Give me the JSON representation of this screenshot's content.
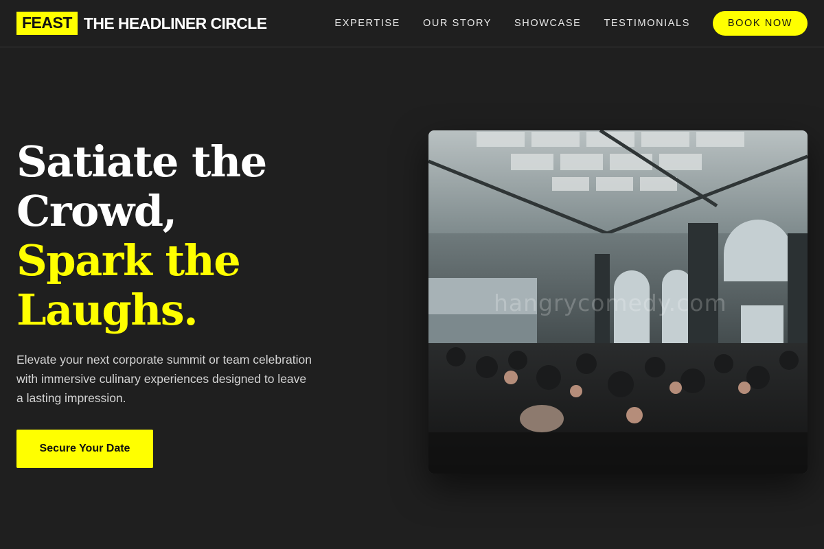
{
  "brand": {
    "badge": "FEAST",
    "name": "THE HEADLINER CIRCLE"
  },
  "nav": {
    "items": [
      {
        "label": "EXPERTISE"
      },
      {
        "label": "OUR STORY"
      },
      {
        "label": "SHOWCASE"
      },
      {
        "label": "TESTIMONIALS"
      }
    ],
    "book_label": "BOOK NOW"
  },
  "hero": {
    "title_lines": [
      "Satiate the",
      "Crowd,",
      "Spark the",
      "Laughs."
    ],
    "subtitle": "Elevate your next corporate summit or team celebration with immersive culinary experiences designed to leave a lasting impression.",
    "cta_label": "Secure Your Date",
    "image_watermark": "hangrycomedy.com"
  },
  "colors": {
    "accent": "#ffff00",
    "background": "#1f1f1f",
    "text": "#ffffff",
    "muted_text": "#d4d4d4"
  }
}
